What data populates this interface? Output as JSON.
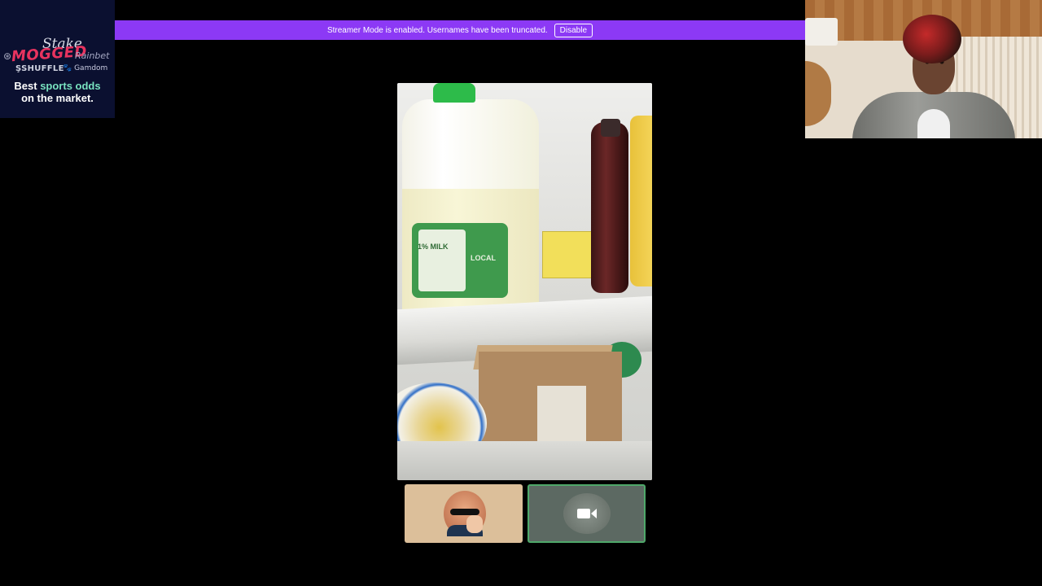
{
  "sponsor": {
    "brands": {
      "stake": "Stake",
      "mogged": "MOGGED",
      "rainbet": "Rainbet",
      "shuffle": "SHUFFLE",
      "gamdom": "Gamdom"
    },
    "tagline_start": "Best ",
    "tagline_highlight": "sports odds",
    "tagline_end": "on the market."
  },
  "banner": {
    "message": "Streamer Mode is enabled. Usernames have been truncated.",
    "disable_label": "Disable",
    "color": "#8c39f5"
  },
  "main_video": {
    "milk_label": "1% MILK",
    "milk_local": "LOCAL"
  },
  "participants": [
    {
      "type": "avatar",
      "icon": "avatar-sunglasses"
    },
    {
      "type": "camera-off",
      "icon": "video-camera-icon",
      "active_border": "#4fa86a"
    }
  ]
}
